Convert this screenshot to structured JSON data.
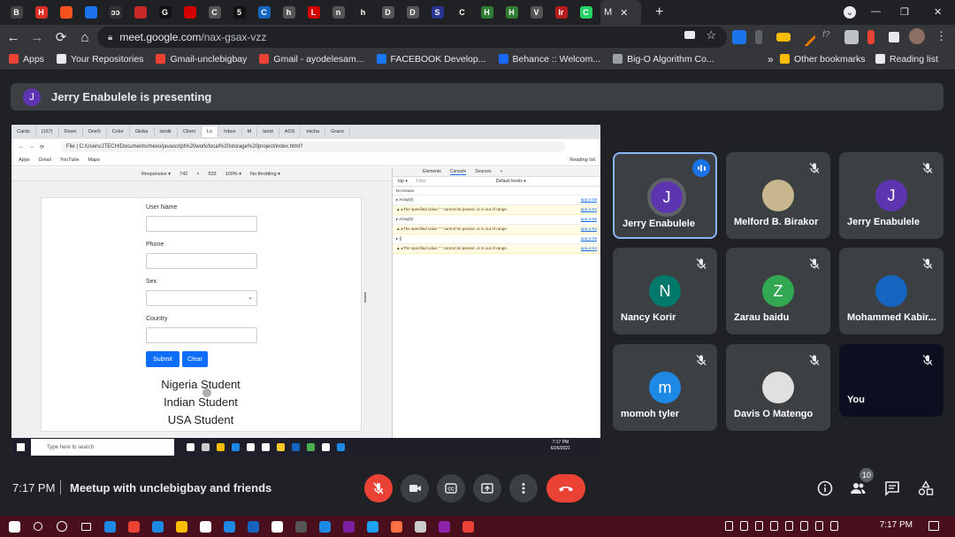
{
  "browser": {
    "tabs": [
      {
        "label": "B",
        "color": "#444"
      },
      {
        "label": "H",
        "color": "#d93025"
      },
      {
        "label": "",
        "color": "#f4511e"
      },
      {
        "label": "",
        "color": "#1a73e8"
      },
      {
        "label": "ↄↄ",
        "color": "#333"
      },
      {
        "label": "",
        "color": "#c62828"
      },
      {
        "label": "G",
        "color": "#111"
      },
      {
        "label": "",
        "color": "#d50000"
      },
      {
        "label": "C",
        "color": "#555"
      },
      {
        "label": "5",
        "color": "#111"
      },
      {
        "label": "C",
        "color": "#1565c0"
      },
      {
        "label": "h",
        "color": "#555"
      },
      {
        "label": "L",
        "color": "#d50000"
      },
      {
        "label": "n",
        "color": "#555"
      },
      {
        "label": "h",
        "color": "#222"
      },
      {
        "label": "D",
        "color": "#555"
      },
      {
        "label": "D",
        "color": "#555"
      },
      {
        "label": "S",
        "color": "#283593"
      },
      {
        "label": "C",
        "color": "#222"
      },
      {
        "label": "H",
        "color": "#2e7d32"
      },
      {
        "label": "H",
        "color": "#2e7d32"
      },
      {
        "label": "V",
        "color": "#555"
      },
      {
        "label": "Ir",
        "color": "#b71c1c"
      },
      {
        "label": "C",
        "color": "#25d366"
      }
    ],
    "active_tab_label": "M",
    "url_host": "meet.google.com",
    "url_path": "/nax-gsax-vzz",
    "bookmarks": [
      {
        "label": "Apps",
        "color": "#ea4335"
      },
      {
        "label": "Your Repositories",
        "color": "#e8eaed"
      },
      {
        "label": "Gmail-unclebigbay",
        "color": "#ea4335"
      },
      {
        "label": "Gmail - ayodelesam...",
        "color": "#ea4335"
      },
      {
        "label": "FACEBOOK Develop...",
        "color": "#1877f2"
      },
      {
        "label": "Behance :: Welcom...",
        "color": "#1769ff"
      },
      {
        "label": "Big-O Algorithm Co...",
        "color": "#9aa0a6"
      }
    ],
    "other_bookmarks": "Other bookmarks",
    "reading_list": "Reading list"
  },
  "presenting": {
    "avatar": "J",
    "text": "Jerry Enabulele is presenting"
  },
  "shared_screen": {
    "tabs": [
      "Cards",
      "(157)",
      "Down",
      "OneS",
      "Color",
      "Globa",
      "landir",
      "Client",
      "Lo",
      "Inbox",
      "M",
      "landi",
      "AOS",
      "micha",
      "Grace"
    ],
    "file_label": "File",
    "file_path": "C:/Users/JTECH/Documents/mexo/javascript%20work/local%20storage%20project/index.html?",
    "bookmarks": [
      "Apps",
      "Gmail",
      "YouTube",
      "Maps"
    ],
    "reading_list": "Reading list",
    "responsive_bar": [
      "Responsive ▾",
      "742",
      "×",
      "533",
      "100% ▾",
      "No throttling ▾"
    ],
    "form": {
      "user_name_label": "User Name",
      "phone_label": "Phone",
      "sex_label": "Sex",
      "country_label": "Country",
      "submit": "Submit",
      "clear": "Clear"
    },
    "students": [
      "Nigeria Student",
      "Indian Student",
      "USA Student"
    ],
    "devtools": {
      "tabs": [
        "Elements",
        "Console",
        "Sources",
        "»"
      ],
      "top": "top ▾",
      "filter": "Filter",
      "levels": "Default levels ▾",
      "no_issues": "No Issues",
      "lines": [
        {
          "text": "▸ Array(0)",
          "src": "app.js:58",
          "warn": false
        },
        {
          "text": "▲ ▸The specified value \" \" cannot be parsed, or is out of range.",
          "src": "app.js:84",
          "warn": true
        },
        {
          "text": "▸ Array(0)",
          "src": "app.js:58",
          "warn": false
        },
        {
          "text": "▲ ▸The specified value \" \" cannot be parsed, or is out of range.",
          "src": "app.js:84",
          "warn": true
        },
        {
          "text": "▸ {}",
          "src": "app.js:58",
          "warn": false
        },
        {
          "text": "▲ ▸The specified value \" \" cannot be parsed, or is out of range.",
          "src": "app.js:84",
          "warn": true
        }
      ]
    },
    "taskbar_search": "Type here to search",
    "taskbar_time": "7:17 PM",
    "taskbar_date": "6/26/2021"
  },
  "participants": [
    {
      "name": "Jerry Enabulele",
      "initial": "J",
      "color": "#5e35b1",
      "speaking": true
    },
    {
      "name": "Melford B. Birakor",
      "initial": "",
      "color": "#c8b68e",
      "speaking": false
    },
    {
      "name": "Jerry Enabulele",
      "initial": "J",
      "color": "#5e35b1",
      "speaking": false
    },
    {
      "name": "Nancy Korir",
      "initial": "N",
      "color": "#00796b",
      "speaking": false
    },
    {
      "name": "Zarau baidu",
      "initial": "Z",
      "color": "#33a852",
      "speaking": false
    },
    {
      "name": "Mohammed Kabir...",
      "initial": "",
      "color": "#1565c0",
      "speaking": false
    },
    {
      "name": "momoh tyler",
      "initial": "m",
      "color": "#1e88e5",
      "speaking": false
    },
    {
      "name": "Davis O Matengo",
      "initial": "",
      "color": "#e0e0e0",
      "speaking": false
    },
    {
      "name": "You",
      "initial": "",
      "color": "#1a1a2e",
      "speaking": false
    }
  ],
  "bottom_bar": {
    "time": "7:17 PM",
    "meeting_name": "Meetup with unclebigbay and friends",
    "participant_count": "10"
  },
  "windows_taskbar": {
    "time": "7:17 PM"
  }
}
